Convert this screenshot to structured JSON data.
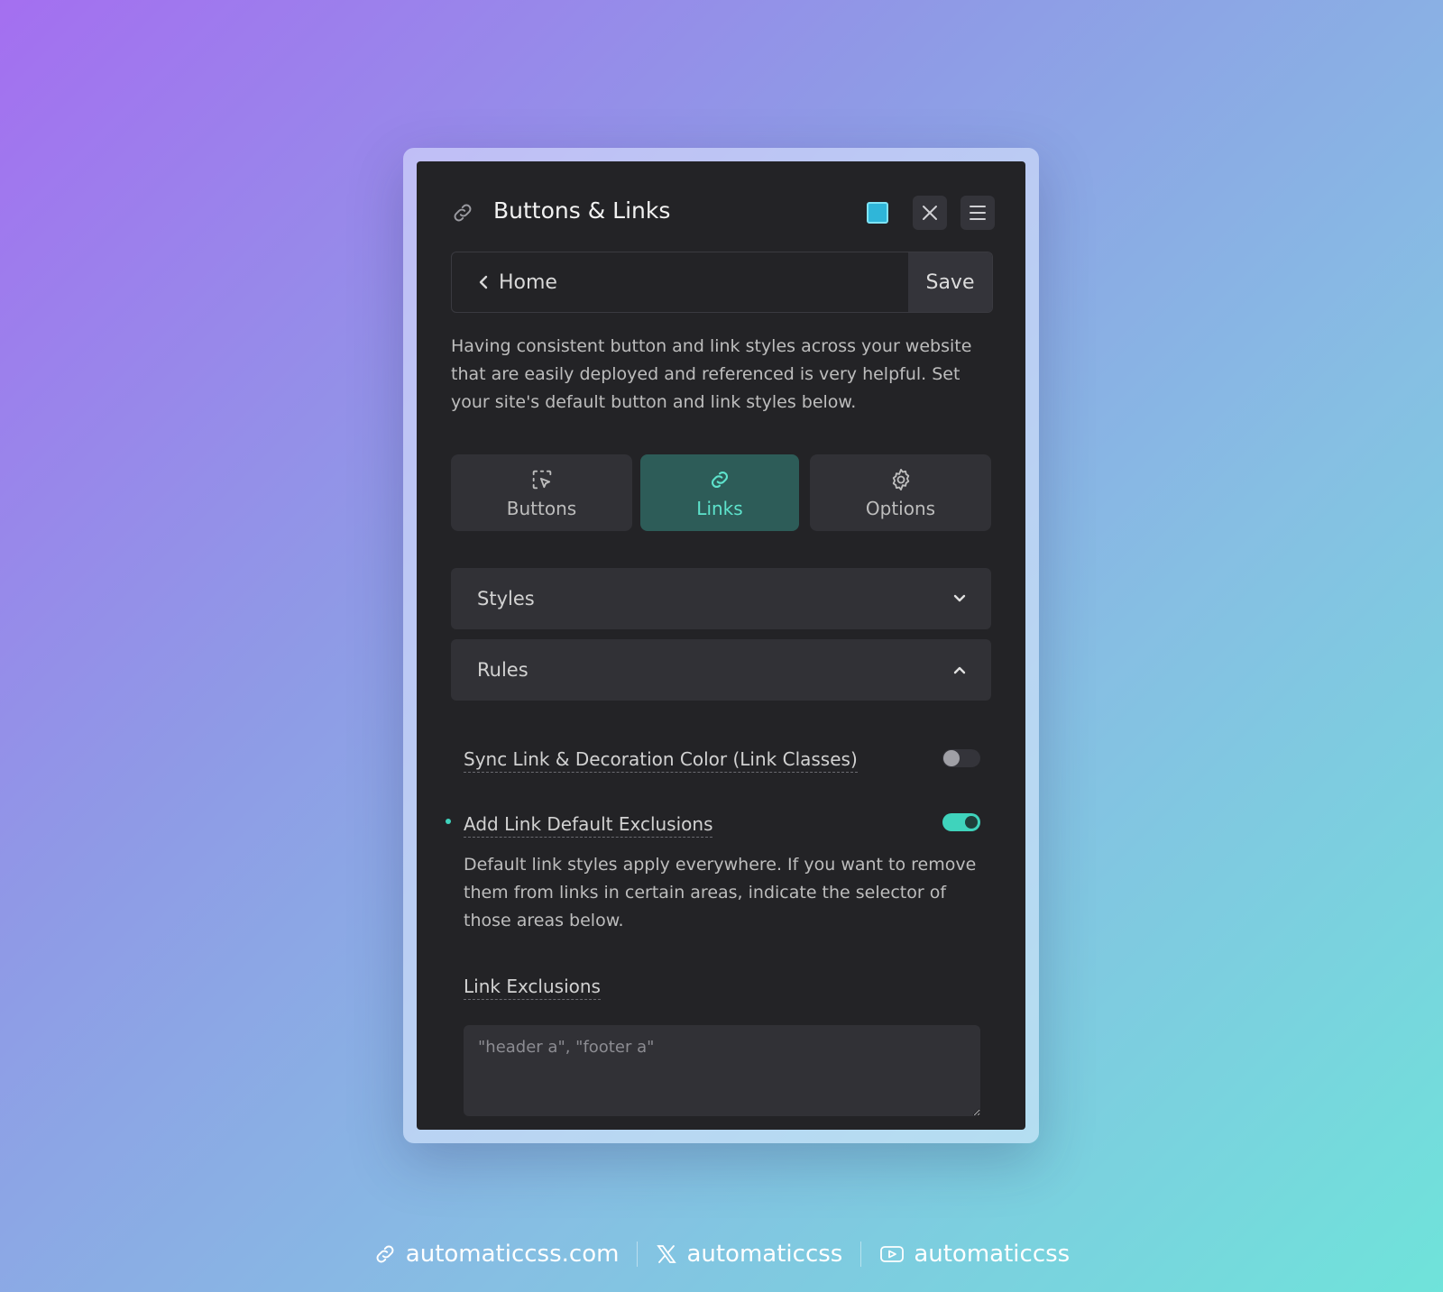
{
  "panel": {
    "title": "Buttons & Links",
    "accent_color": "#3fd3bc",
    "header_icons": [
      "link-icon",
      "square-icon",
      "close-icon",
      "menu-icon"
    ]
  },
  "nav": {
    "back_label": "Home",
    "save_label": "Save"
  },
  "intro": "Having consistent button and link styles across your website that are easily deployed and referenced is very helpful. Set your site's default button and link styles below.",
  "tabs": [
    {
      "label": "Buttons",
      "icon": "pointer-select-icon",
      "active": false
    },
    {
      "label": "Links",
      "icon": "link-chain-icon",
      "active": true
    },
    {
      "label": "Options",
      "icon": "gear-icon",
      "active": false
    }
  ],
  "accordions": {
    "styles": {
      "label": "Styles",
      "expanded": false
    },
    "rules": {
      "label": "Rules",
      "expanded": true
    }
  },
  "rules": {
    "sync": {
      "label": "Sync Link & Decoration Color (Link Classes)",
      "on": false
    },
    "exclusions_toggle": {
      "label": "Add Link Default Exclusions",
      "on": true
    },
    "exclusions_desc": "Default link styles apply everywhere. If you want to remove them from links in certain areas, indicate the selector of those areas below.",
    "exclusions_field_label": "Link Exclusions",
    "exclusions_placeholder": "\"header a\", \"footer a\"",
    "exclusions_value": ""
  },
  "footer": {
    "website": "automaticcss.com",
    "x_handle": "automaticcss",
    "youtube_handle": "automaticcss"
  }
}
